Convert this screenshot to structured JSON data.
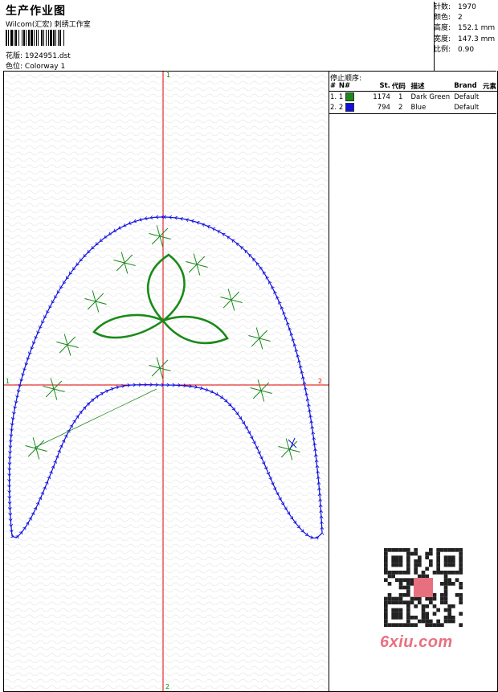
{
  "header": {
    "title": "生产作业图",
    "company": "Wilcom(汇宏) 刺绣工作室",
    "design_label": "花版:",
    "design_value": "1924951.dst",
    "colorway_label": "色位:",
    "colorway_value": "Colorway 1"
  },
  "stats": [
    {
      "label": "针数:",
      "value": "1970"
    },
    {
      "label": "颜色:",
      "value": "2"
    },
    {
      "label": "高度:",
      "value": "152.1 mm"
    },
    {
      "label": "宽度:",
      "value": "147.3 mm"
    },
    {
      "label": "比例:",
      "value": "0.90"
    }
  ],
  "stop_sequence": {
    "title": "停止顺序:",
    "columns": [
      "#",
      "N#",
      "St.",
      "代码",
      "描述",
      "Brand",
      "元素"
    ],
    "rows": [
      {
        "idx": "1.",
        "n": "1",
        "color": "#1a8a1a",
        "stitches": "1174",
        "code": "1",
        "description": "Dark Green",
        "brand": "Default",
        "element": ""
      },
      {
        "idx": "2.",
        "n": "2",
        "color": "#1010e0",
        "stitches": "794",
        "code": "2",
        "description": "Blue",
        "brand": "Default",
        "element": ""
      }
    ]
  },
  "axes": {
    "top": "1",
    "bottom": "2",
    "left": "1",
    "right": "2"
  },
  "colors": {
    "axis": "#e00000",
    "green": "#1a8a1a",
    "blue": "#1010e0",
    "watermark": "#e8707e"
  },
  "watermark": {
    "text": "6xiu.com"
  }
}
